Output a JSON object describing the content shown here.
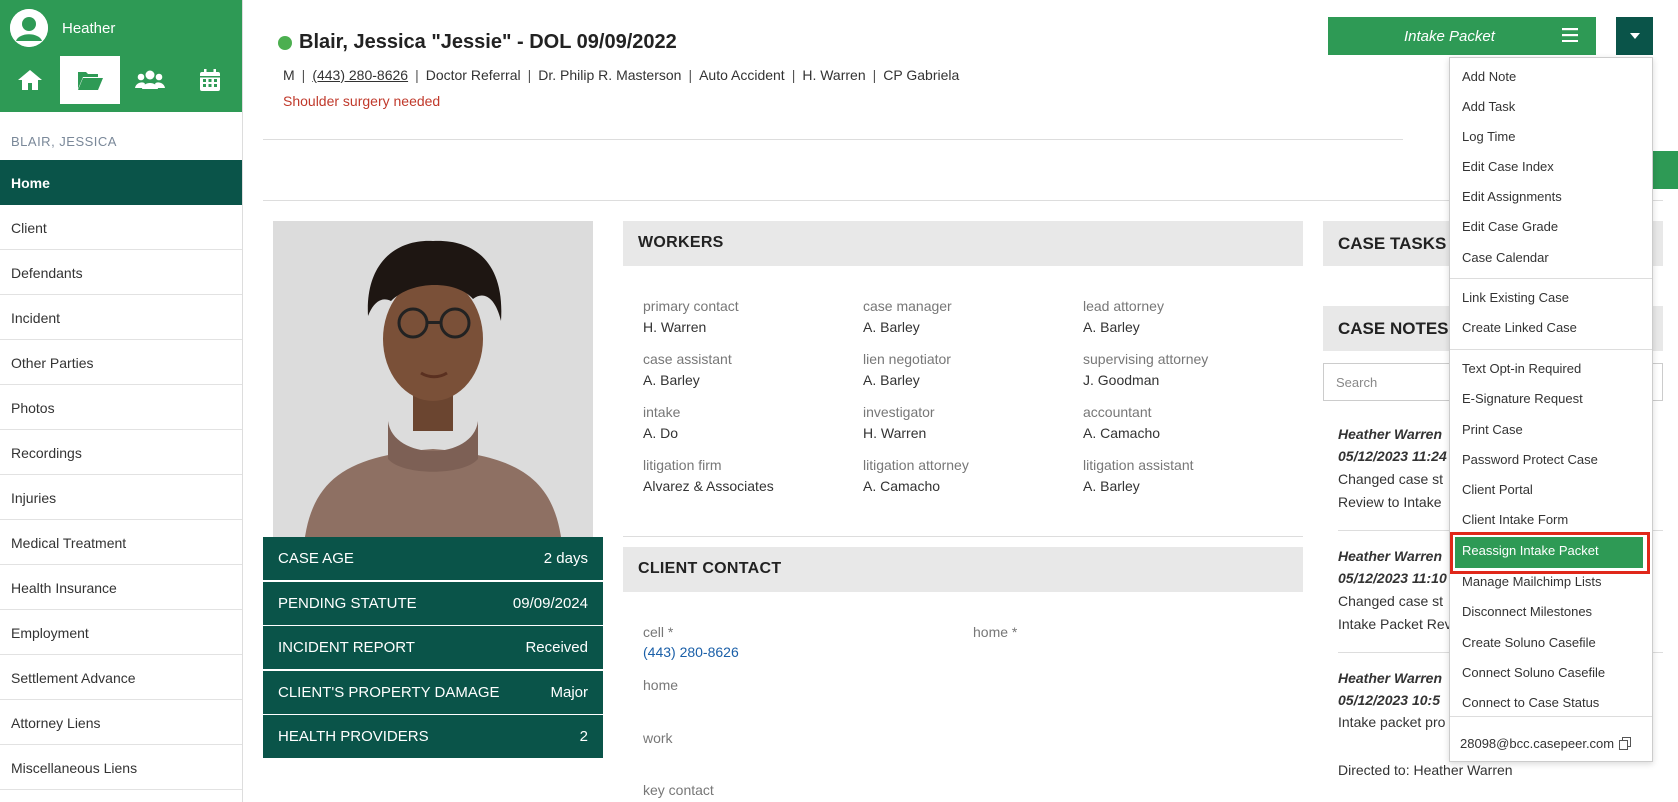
{
  "sidebar": {
    "user_name": "Heather",
    "case_label": "BLAIR, JESSICA",
    "items": [
      {
        "label": "Home",
        "name": "sidebar-item-home"
      },
      {
        "label": "Client",
        "name": "sidebar-item-client"
      },
      {
        "label": "Defendants",
        "name": "sidebar-item-defendants"
      },
      {
        "label": "Incident",
        "name": "sidebar-item-incident"
      },
      {
        "label": "Other Parties",
        "name": "sidebar-item-other-parties"
      },
      {
        "label": "Photos",
        "name": "sidebar-item-photos"
      },
      {
        "label": "Recordings",
        "name": "sidebar-item-recordings"
      },
      {
        "label": "Injuries",
        "name": "sidebar-item-injuries"
      },
      {
        "label": "Medical Treatment",
        "name": "sidebar-item-medical-treatment"
      },
      {
        "label": "Health Insurance",
        "name": "sidebar-item-health-insurance"
      },
      {
        "label": "Employment",
        "name": "sidebar-item-employment"
      },
      {
        "label": "Settlement Advance",
        "name": "sidebar-item-settlement-advance"
      },
      {
        "label": "Attorney Liens",
        "name": "sidebar-item-attorney-liens"
      },
      {
        "label": "Miscellaneous Liens",
        "name": "sidebar-item-miscellaneous-liens"
      }
    ]
  },
  "header": {
    "title": "Blair, Jessica \"Jessie\" - DOL 09/09/2022",
    "meta": [
      "M",
      "(443) 280-8626",
      "Doctor Referral",
      "Dr. Philip R. Masterson",
      "Auto Accident",
      "H. Warren",
      "CP Gabriela"
    ],
    "alert": "Shoulder surgery needed",
    "intake_button": "Intake Packet"
  },
  "stats": [
    {
      "label": "CASE AGE",
      "value": "2 days"
    },
    {
      "label": "PENDING STATUTE",
      "value": "09/09/2024"
    },
    {
      "label": "INCIDENT REPORT",
      "value": "Received"
    },
    {
      "label": "CLIENT'S PROPERTY DAMAGE",
      "value": "Major"
    },
    {
      "label": "HEALTH PROVIDERS",
      "value": "2"
    }
  ],
  "workers": {
    "title": "WORKERS",
    "cells": [
      {
        "label": "primary contact",
        "value": "H. Warren"
      },
      {
        "label": "case manager",
        "value": "A. Barley"
      },
      {
        "label": "lead attorney",
        "value": "A. Barley"
      },
      {
        "label": "case assistant",
        "value": "A. Barley"
      },
      {
        "label": "lien negotiator",
        "value": "A. Barley"
      },
      {
        "label": "supervising attorney",
        "value": "J. Goodman"
      },
      {
        "label": "intake",
        "value": "A. Do"
      },
      {
        "label": "investigator",
        "value": "H. Warren"
      },
      {
        "label": "accountant",
        "value": "A. Camacho"
      },
      {
        "label": "litigation firm",
        "value": "Alvarez & Associates"
      },
      {
        "label": "litigation attorney",
        "value": "A. Camacho"
      },
      {
        "label": "litigation assistant",
        "value": "A. Barley"
      }
    ]
  },
  "client_contact": {
    "title": "CLIENT CONTACT",
    "cell_label": "cell *",
    "cell_value": "(443) 280-8626",
    "home_label_right": "home *",
    "home_label": "home",
    "work_label": "work",
    "key_contact_label": "key contact"
  },
  "case_tasks": {
    "title": "CASE TASKS"
  },
  "case_notes": {
    "title": "CASE NOTES",
    "search_placeholder": "Search",
    "notes": [
      {
        "author": "Heather Warren",
        "date": "05/12/2023 11:24",
        "line1": "Changed case st",
        "line2": "Review to Intake"
      },
      {
        "author": "Heather Warren",
        "date": "05/12/2023 11:10",
        "line1": "Changed case st",
        "line2": "Intake Packet Rev"
      },
      {
        "author": "Heather Warren",
        "date": "05/12/2023 10:5",
        "line1": "Intake packet pro",
        "line2": "Directed to: Heather Warren"
      }
    ]
  },
  "dropdown": {
    "items": [
      "Add Note",
      "Add Task",
      "Log Time",
      "Edit Case Index",
      "Edit Assignments",
      "Edit Case Grade",
      "Case Calendar",
      "Link Existing Case",
      "Create Linked Case",
      "Text Opt-in Required",
      "E-Signature Request",
      "Print Case",
      "Password Protect Case",
      "Client Portal",
      "Client Intake Form",
      "Reassign Intake Packet",
      "Manage Mailchimp Lists",
      "Disconnect Milestones",
      "Create Soluno Casefile",
      "Connect Soluno Casefile",
      "Connect to Case Status"
    ],
    "email": "28098@bcc.casepeer.com"
  },
  "colors": {
    "brand_green": "#2e9a55",
    "dark_teal": "#0a5449",
    "alert_red": "#c0392b",
    "highlight_border": "#e0281a"
  }
}
